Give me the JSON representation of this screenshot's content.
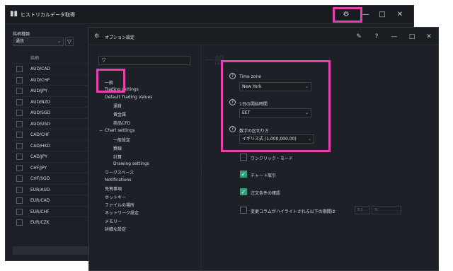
{
  "background_window": {
    "title": "ヒストリカルデータ取得",
    "app_icon": "chart-bars-icon",
    "controls": {
      "settings": "⚙",
      "minimize": "—",
      "maximize": "□",
      "close": "✕"
    },
    "symbol_type_label": "銘柄種類",
    "symbol_type_value": "通貨",
    "list_header": "銘柄",
    "symbols": [
      "AUD/CAD",
      "AUD/CHF",
      "AUD/JPY",
      "AUD/NZD",
      "AUD/SGD",
      "AUD/USD",
      "CAD/CHF",
      "CAD/HKD",
      "CAD/JPY",
      "CHF/JPY",
      "CHF/SGD",
      "EUR/AUD",
      "EUR/CAD",
      "EUR/CHF",
      "EUR/CZK"
    ]
  },
  "dialog": {
    "title": "オプション設定",
    "controls": {
      "pin": "✎",
      "help": "?",
      "minimize": "—",
      "maximize": "□",
      "close": "✕"
    },
    "tree_filter_icon": "filter-icon",
    "tree": {
      "general": "一般",
      "trading_settings": "Trading settings",
      "default_trading_values": "Default Trading Values",
      "currency": "通貨",
      "precious_metals": "貴金属",
      "stock_cfd": "商品CFD",
      "chart_settings": "Chart settings",
      "chart_general": "一般設定",
      "grid": "罫線",
      "calculation": "計算",
      "drawing_settings": "Drawing settings",
      "workspace": "ワークスペース",
      "notifications": "Notifications",
      "disclaimer": "免責事項",
      "hotkeys": "ホットキー",
      "file_location": "ファイルの場所",
      "network": "ネットワーク設定",
      "memory": "メモリー",
      "advanced": "詳細な設定"
    },
    "chart_general_expander": "−",
    "right_ghost": "一般",
    "settings": {
      "timezone_label": "Time zone",
      "timezone_value": "New York",
      "day_start_label": "1日の開始時間",
      "day_start_value": "EET",
      "number_sep_label": "数字の区切り方",
      "number_sep_value": "イギリス式 (1,000,000.00)",
      "one_click_label": "ワンクリック・モード",
      "one_click_checked": false,
      "chart_trading_label": "チャート取引",
      "chart_trading_checked": true,
      "order_confirm_label": "注文条件の確認",
      "order_confirm_checked": true,
      "highlight_label": "変更コラムがハイライトされる以下の期間は",
      "highlight_value1": "0.1",
      "highlight_value2": "%"
    }
  }
}
